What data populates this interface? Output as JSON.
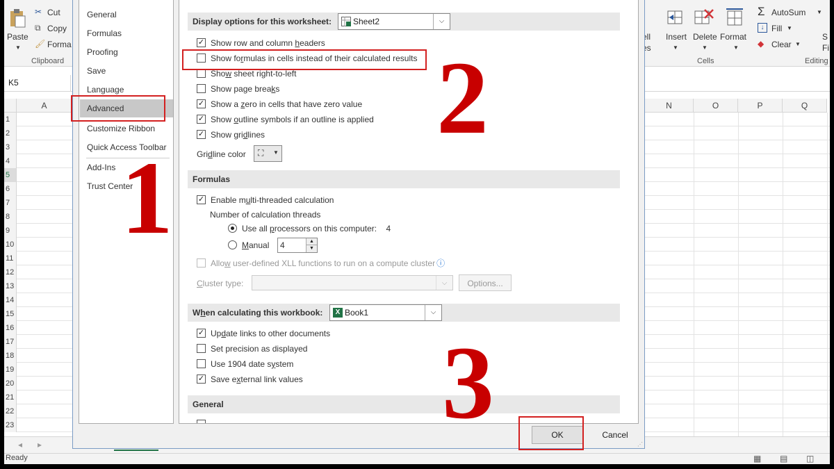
{
  "ribbon": {
    "paste": "Paste",
    "cut": "Cut",
    "copy": "Copy",
    "format_painter": "Forma",
    "clipboard_group": "Clipboard",
    "cell_label": "ell",
    "cell_sub": "es",
    "insert": "Insert",
    "delete": "Delete",
    "format": "Format",
    "cells_group": "Cells",
    "autosum": "AutoSum",
    "fill": "Fill",
    "clear": "Clear",
    "editing_group": "Editing",
    "edge_s": "S",
    "edge_f": "Fi"
  },
  "formula_bar": {
    "name_box": "K5"
  },
  "columns_left": [
    "A"
  ],
  "columns_right": [
    "N",
    "O",
    "P",
    "Q"
  ],
  "rows": [
    "1",
    "2",
    "3",
    "4",
    "5",
    "6",
    "7",
    "8",
    "9",
    "10",
    "11",
    "12",
    "13",
    "14",
    "15",
    "16",
    "17",
    "18",
    "19",
    "20",
    "21",
    "22",
    "23"
  ],
  "status": {
    "text": "Ready"
  },
  "dialog": {
    "nav": [
      "General",
      "Formulas",
      "Proofing",
      "Save",
      "Language",
      "Advanced",
      "Customize Ribbon",
      "Quick Access Toolbar",
      "Add-Ins",
      "Trust Center"
    ],
    "display": {
      "label": "Display options for this worksheet:",
      "sheet": "Sheet2",
      "options": [
        {
          "pre": "Show row and column ",
          "u": "h",
          "post": "eaders",
          "checked": true
        },
        {
          "pre": "Show fo",
          "u": "r",
          "post": "mulas in cells instead of their calculated results",
          "checked": false
        },
        {
          "pre": "Sho",
          "u": "w",
          "post": " sheet right-to-left",
          "checked": false
        },
        {
          "pre": "Show page brea",
          "u": "k",
          "post": "s",
          "checked": false
        },
        {
          "pre": "Show a ",
          "u": "z",
          "post": "ero in cells that have zero value",
          "checked": true
        },
        {
          "pre": "Show ",
          "u": "o",
          "post": "utline symbols if an outline is applied",
          "checked": true
        },
        {
          "pre": "Show gri",
          "u": "d",
          "post": "lines",
          "checked": true
        }
      ],
      "gridline_pre": "Gri",
      "gridline_u": "d",
      "gridline_post": "line color"
    },
    "formulas": {
      "title": "Formulas",
      "multithread_pre": "Enable m",
      "multithread_u": "u",
      "multithread_post": "lti-threaded calculation",
      "threads_label": "Number of calculation threads",
      "all_pre": "Use all ",
      "all_u": "p",
      "all_post": "rocessors on this computer:",
      "all_count": "4",
      "manual_u": "M",
      "manual_post": "anual",
      "manual_value": "4",
      "xll_pre": "Allo",
      "xll_u": "w",
      "xll_post": " user-defined XLL functions to run on a compute cluster",
      "cluster_u": "C",
      "cluster_post": "luster type:",
      "options_btn": "Options..."
    },
    "workbook": {
      "label_pre": "W",
      "label_u": "h",
      "label_post": "en calculating this workbook:",
      "book": "Book1",
      "options": [
        {
          "pre": "Up",
          "u": "d",
          "post": "ate links to other documents",
          "checked": true
        },
        {
          "pre": "Set precision as displayed",
          "u": "",
          "post": "",
          "checked": false
        },
        {
          "pre": "Use 1904 date s",
          "u": "y",
          "post": "stem",
          "checked": false
        },
        {
          "pre": "Save e",
          "u": "x",
          "post": "ternal link values",
          "checked": true
        }
      ]
    },
    "general_title": "General",
    "ok": "OK",
    "cancel": "Cancel"
  },
  "annotations": {
    "step1": "1",
    "step2": "2",
    "step3": "3",
    "color": "#c80000"
  }
}
